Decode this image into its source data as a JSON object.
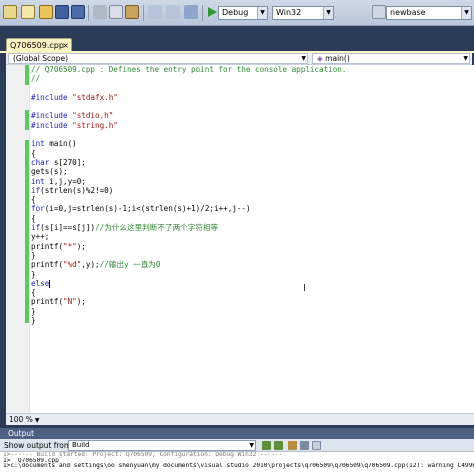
{
  "toolbar": {
    "config_value": "Debug",
    "platform_value": "Win32",
    "search_value": "newbase",
    "colors": {
      "background": "#c3cee0",
      "combo_bg": "#ffffff"
    }
  },
  "tab": {
    "title": "Q706509.cpp",
    "close_glyph": "×"
  },
  "scope": {
    "left": "(Global Scope)",
    "right": "main()",
    "arrow": "▼"
  },
  "editor": {
    "code_lines": [
      "// Q706509.cpp : Defines the entry point for the console application.",
      "//",
      "",
      "#include \"stdafx.h\"",
      "",
      "#include \"stdio.h\"",
      "#include \"string.h\"",
      "",
      "int main()",
      "{",
      "char s[270];",
      "gets(s);",
      "int i,j,y=0;",
      "if(strlen(s)%2!=0)",
      "{",
      "for(i=0,j=strlen(s)-1;i<(strlen(s)+1)/2;i++,j--)",
      "{",
      "if(s[i]==s[j])//为什么这里判断不了两个字符相等",
      "y++;",
      "printf(\"*\");",
      "}",
      "printf(\"%d\",y);//输出y 一直为0",
      "}",
      "else",
      "{",
      "printf(\"N\");",
      "}",
      "}"
    ],
    "zoom": "100 %"
  },
  "output": {
    "title": "Output",
    "show_from_label": "Show output from:",
    "show_from_value": "Build",
    "lines": [
      "1>------ Build started: Project: Q706509, Configuration: Debug Win32 ------",
      "1>  Q706509.cpp",
      "1>c:\\documents and settings\\oo shenyuan\\my documents\\visual studio 2010\\projects\\q706509\\q706509\\q706509.cpp(12): warning C4996: "
    ]
  }
}
